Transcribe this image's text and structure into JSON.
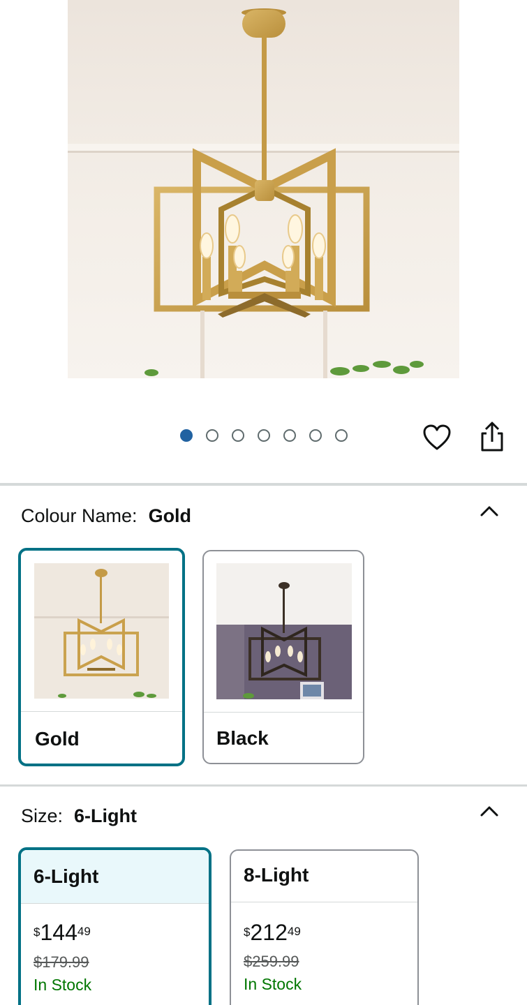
{
  "gallery": {
    "image_count": 7,
    "active_index": 0
  },
  "actions": {
    "wishlist_icon": "heart-icon",
    "share_icon": "share-icon"
  },
  "colour": {
    "label": "Colour Name:",
    "selected": "Gold",
    "options": [
      {
        "name": "Gold",
        "selected": true
      },
      {
        "name": "Black",
        "selected": false
      }
    ]
  },
  "size": {
    "label": "Size:",
    "selected": "6-Light",
    "options": [
      {
        "name": "6-Light",
        "currency": "$",
        "whole": "144",
        "fraction": "49",
        "list_price": "$179.99",
        "availability": "In Stock",
        "selected": true
      },
      {
        "name": "8-Light",
        "currency": "$",
        "whole": "212",
        "fraction": "49",
        "list_price": "$259.99",
        "availability": "In Stock",
        "selected": false
      }
    ]
  },
  "colors": {
    "accent": "#007185",
    "dot_active": "#2162a1",
    "in_stock": "#007600",
    "gold": "#c9a24e",
    "black_finish": "#3b3026"
  }
}
